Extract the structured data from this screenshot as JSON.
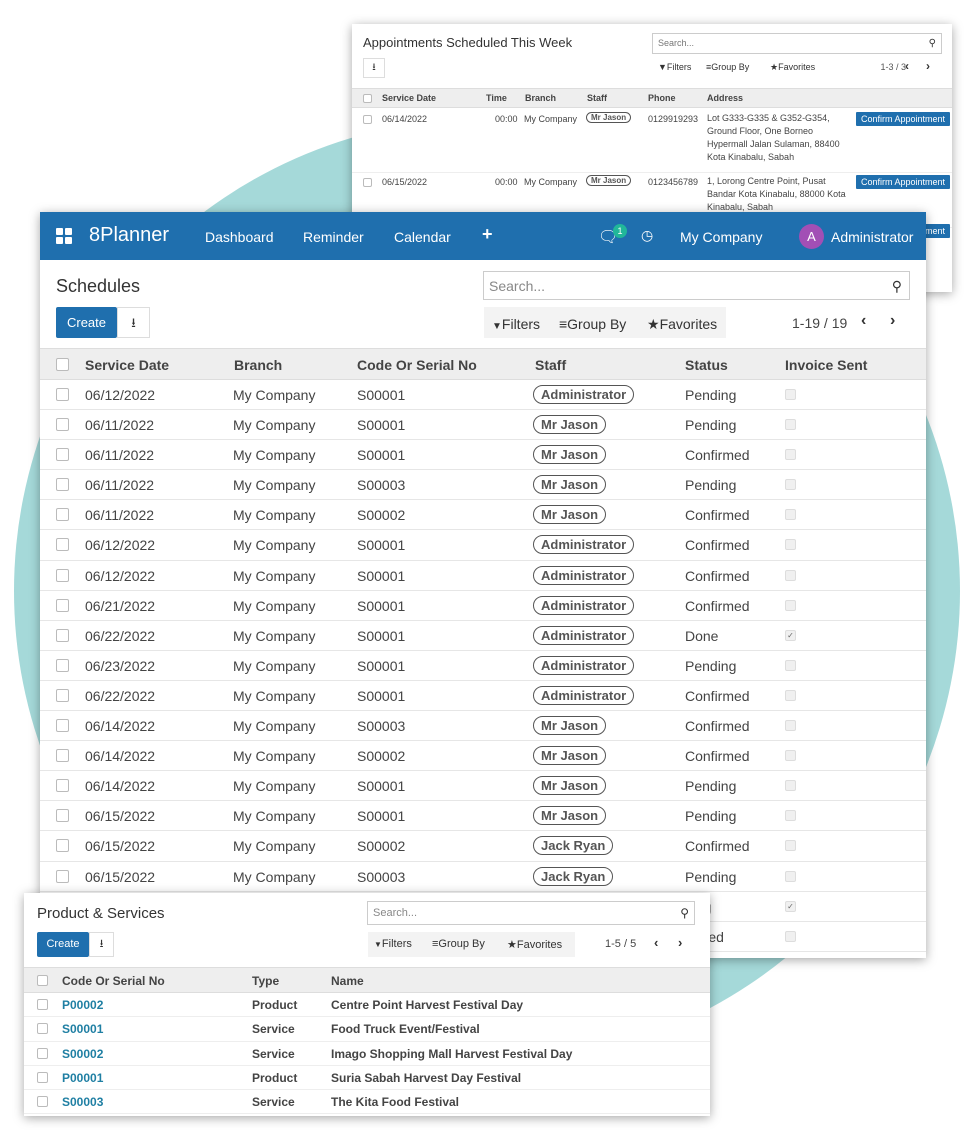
{
  "appointments": {
    "title": "Appointments Scheduled This Week",
    "search_placeholder": "Search...",
    "filters_label": "Filters",
    "groupby_label": "Group By",
    "favorites_label": "Favorites",
    "pager": "1-3 / 3",
    "columns": [
      "Service Date",
      "Time",
      "Branch",
      "Staff",
      "Phone",
      "Address"
    ],
    "rows": [
      {
        "date": "06/14/2022",
        "time": "00:00",
        "branch": "My Company",
        "staff": "Mr Jason",
        "phone": "0129919293",
        "address": "Lot G333-G335 & G352-G354, Ground Floor, One Borneo Hypermall Jalan Sulaman, 88400 Kota Kinabalu, Sabah",
        "action": "Confirm Appointment"
      },
      {
        "date": "06/15/2022",
        "time": "00:00",
        "branch": "My Company",
        "staff": "Mr Jason",
        "phone": "0123456789",
        "address": "1, Lorong Centre Point, Pusat Bandar Kota Kinabalu, 88000 Kota Kinabalu, Sabah",
        "action": "Confirm Appointment"
      }
    ],
    "partial_button": "ment"
  },
  "navbar": {
    "brand": "8Planner",
    "menu": [
      "Dashboard",
      "Reminder",
      "Calendar"
    ],
    "plus": "+",
    "chat_badge": "1",
    "company": "My Company",
    "avatar_letter": "A",
    "user": "Administrator"
  },
  "schedules": {
    "title": "Schedules",
    "search_placeholder": "Search...",
    "create_label": "Create",
    "filters_label": "Filters",
    "groupby_label": "Group By",
    "favorites_label": "Favorites",
    "pager": "1-19 / 19",
    "columns": [
      "Service Date",
      "Branch",
      "Code Or Serial No",
      "Staff",
      "Status",
      "Invoice Sent"
    ],
    "rows": [
      {
        "date": "06/12/2022",
        "branch": "My Company",
        "code": "S00001",
        "staff": "Administrator",
        "status": "Pending",
        "invoice": false
      },
      {
        "date": "06/11/2022",
        "branch": "My Company",
        "code": "S00001",
        "staff": "Mr Jason",
        "status": "Pending",
        "invoice": false
      },
      {
        "date": "06/11/2022",
        "branch": "My Company",
        "code": "S00001",
        "staff": "Mr Jason",
        "status": "Confirmed",
        "invoice": false
      },
      {
        "date": "06/11/2022",
        "branch": "My Company",
        "code": "S00003",
        "staff": "Mr Jason",
        "status": "Pending",
        "invoice": false
      },
      {
        "date": "06/11/2022",
        "branch": "My Company",
        "code": "S00002",
        "staff": "Mr Jason",
        "status": "Confirmed",
        "invoice": false
      },
      {
        "date": "06/12/2022",
        "branch": "My Company",
        "code": "S00001",
        "staff": "Administrator",
        "status": "Confirmed",
        "invoice": false
      },
      {
        "date": "06/12/2022",
        "branch": "My Company",
        "code": "S00001",
        "staff": "Administrator",
        "status": "Confirmed",
        "invoice": false
      },
      {
        "date": "06/21/2022",
        "branch": "My Company",
        "code": "S00001",
        "staff": "Administrator",
        "status": "Confirmed",
        "invoice": false
      },
      {
        "date": "06/22/2022",
        "branch": "My Company",
        "code": "S00001",
        "staff": "Administrator",
        "status": "Done",
        "invoice": true
      },
      {
        "date": "06/23/2022",
        "branch": "My Company",
        "code": "S00001",
        "staff": "Administrator",
        "status": "Pending",
        "invoice": false
      },
      {
        "date": "06/22/2022",
        "branch": "My Company",
        "code": "S00001",
        "staff": "Administrator",
        "status": "Confirmed",
        "invoice": false
      },
      {
        "date": "06/14/2022",
        "branch": "My Company",
        "code": "S00003",
        "staff": "Mr Jason",
        "status": "Confirmed",
        "invoice": false
      },
      {
        "date": "06/14/2022",
        "branch": "My Company",
        "code": "S00002",
        "staff": "Mr Jason",
        "status": "Confirmed",
        "invoice": false
      },
      {
        "date": "06/14/2022",
        "branch": "My Company",
        "code": "S00001",
        "staff": "Mr Jason",
        "status": "Pending",
        "invoice": false
      },
      {
        "date": "06/15/2022",
        "branch": "My Company",
        "code": "S00001",
        "staff": "Mr Jason",
        "status": "Pending",
        "invoice": false
      },
      {
        "date": "06/15/2022",
        "branch": "My Company",
        "code": "S00002",
        "staff": "Jack Ryan",
        "status": "Confirmed",
        "invoice": false
      },
      {
        "date": "06/15/2022",
        "branch": "My Company",
        "code": "S00003",
        "staff": "Jack Ryan",
        "status": "Pending",
        "invoice": false
      },
      {
        "date": "",
        "branch": "",
        "code": "",
        "staff": "",
        "status": "ding",
        "invoice": true
      },
      {
        "date": "",
        "branch": "",
        "code": "",
        "staff": "",
        "status": "firmed",
        "invoice": false
      }
    ]
  },
  "products": {
    "title": "Product & Services",
    "search_placeholder": "Search...",
    "create_label": "Create",
    "filters_label": "Filters",
    "groupby_label": "Group By",
    "favorites_label": "Favorites",
    "pager": "1-5 / 5",
    "columns": [
      "Code Or Serial No",
      "Type",
      "Name"
    ],
    "rows": [
      {
        "code": "P00002",
        "type": "Product",
        "name": "Centre Point Harvest Festival Day"
      },
      {
        "code": "S00001",
        "type": "Service",
        "name": "Food Truck Event/Festival"
      },
      {
        "code": "S00002",
        "type": "Service",
        "name": "Imago Shopping Mall Harvest Festival Day"
      },
      {
        "code": "P00001",
        "type": "Product",
        "name": "Suria Sabah Harvest Day Festival"
      },
      {
        "code": "S00003",
        "type": "Service",
        "name": "The Kita Food Festival"
      }
    ]
  }
}
